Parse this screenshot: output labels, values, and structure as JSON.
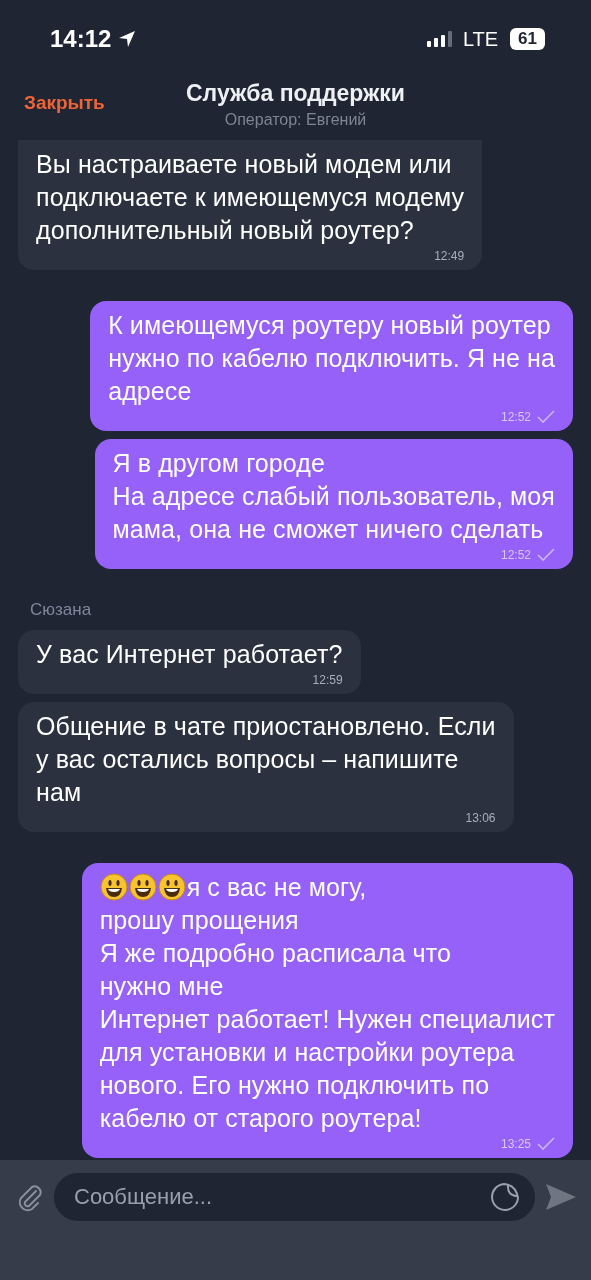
{
  "status_bar": {
    "time": "14:12",
    "network": "LTE",
    "battery": "61"
  },
  "header": {
    "close": "Закрыть",
    "title": "Служба поддержки",
    "subtitle": "Оператор: Евгений"
  },
  "messages": [
    {
      "kind": "in",
      "text": "Вы настраиваете новый модем или\nподключаете к имеющемуся модему\nдополнительный новый роутер?",
      "time": "12:49"
    },
    {
      "kind": "out",
      "text": "К имеющемуся роутеру новый роутер\nнужно по кабелю подключить. Я не на\nадресе",
      "time": "12:52",
      "delivered": true
    },
    {
      "kind": "out",
      "text": "Я в другом городе\nНа адресе слабый пользователь, моя\nмама, она не сможет ничего сделать",
      "time": "12:52",
      "delivered": true
    },
    {
      "kind": "sender",
      "text": "Сюзана"
    },
    {
      "kind": "in",
      "text": "У вас Интернет работает?",
      "time": "12:59"
    },
    {
      "kind": "in",
      "text": "Общение в чате приостановлено. Если\nу вас остались вопросы – напишите\nнам",
      "time": "13:06"
    },
    {
      "kind": "out",
      "smileys_before": true,
      "text": "я с вас не могу,\nпрошу прощения\nЯ же подробно расписала что\nнужно мне\nИнтернет работает! Нужен специалист\nдля установки и настройки роутера\nнового. Его нужно подключить по\nкабелю от старого роутера!",
      "time": "13:25",
      "delivered": true
    }
  ],
  "composer": {
    "placeholder": "Сообщение..."
  }
}
